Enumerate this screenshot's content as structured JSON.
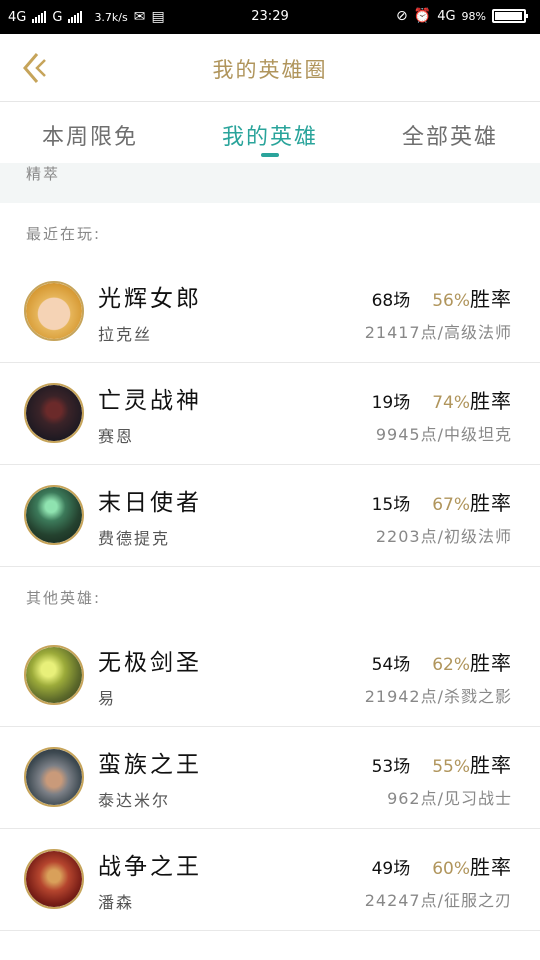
{
  "status_bar": {
    "network1": "4G",
    "network2": "G",
    "speed": "3.7k/s",
    "time": "23:29",
    "network3": "4G",
    "battery": "98%",
    "battery_level": 0.98
  },
  "header": {
    "title": "我的英雄圈"
  },
  "tabs": [
    {
      "label": "本周限免"
    },
    {
      "label": "我的英雄"
    },
    {
      "label": "全部英雄"
    }
  ],
  "partial_section": {
    "label": "精萃"
  },
  "sections": [
    {
      "header": "最近在玩:",
      "heroes": [
        {
          "name": "光辉女郎",
          "title": "拉克丝",
          "games": "68场",
          "rate": "56%",
          "rate_label": "胜率",
          "points": "21417点/高级法师"
        },
        {
          "name": "亡灵战神",
          "title": "赛恩",
          "games": "19场",
          "rate": "74%",
          "rate_label": "胜率",
          "points": "9945点/中级坦克"
        },
        {
          "name": "末日使者",
          "title": "费德提克",
          "games": "15场",
          "rate": "67%",
          "rate_label": "胜率",
          "points": "2203点/初级法师"
        }
      ]
    },
    {
      "header": "其他英雄:",
      "heroes": [
        {
          "name": "无极剑圣",
          "title": "易",
          "games": "54场",
          "rate": "62%",
          "rate_label": "胜率",
          "points": "21942点/杀戮之影"
        },
        {
          "name": "蛮族之王",
          "title": "泰达米尔",
          "games": "53场",
          "rate": "55%",
          "rate_label": "胜率",
          "points": "962点/见习战士"
        },
        {
          "name": "战争之王",
          "title": "潘森",
          "games": "49场",
          "rate": "60%",
          "rate_label": "胜率",
          "points": "24247点/征服之刃"
        }
      ]
    }
  ],
  "colors": {
    "accent": "#2aa49b",
    "gold": "#b0955c"
  }
}
